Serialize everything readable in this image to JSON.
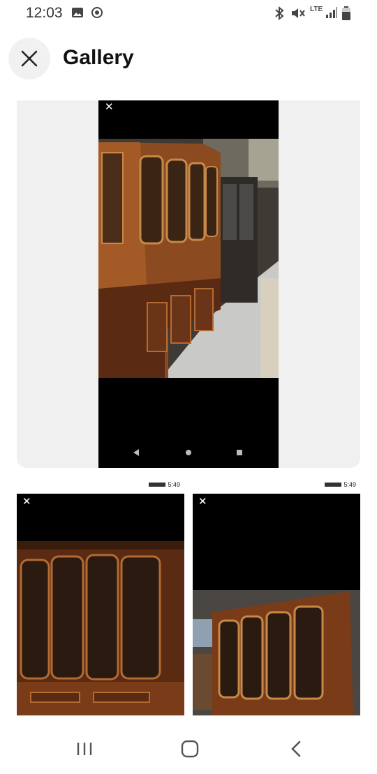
{
  "status_bar": {
    "time": "12:03",
    "network_label": "LTE",
    "icons": [
      "gallery-icon",
      "radio-icon",
      "bluetooth-icon",
      "mute-icon",
      "lte-icon",
      "signal-icon",
      "battery-icon"
    ]
  },
  "header": {
    "title": "Gallery",
    "close_icon": "close-icon"
  },
  "main_photo": {
    "close_glyph": "✕",
    "nav_icons": [
      "back-triangle-icon",
      "home-dot-icon",
      "recents-square-icon"
    ]
  },
  "thumbnails": [
    {
      "time": "5:49",
      "close_glyph": "✕"
    },
    {
      "time": "5:49",
      "close_glyph": "✕"
    }
  ],
  "nav_bar": {
    "icons": [
      "recents-icon",
      "home-icon",
      "back-icon"
    ]
  },
  "colors": {
    "wood_dark": "#5a2a12",
    "wood_mid": "#8b4a20",
    "wood_light": "#b66b33",
    "floor": "#c9c9c7",
    "card_bg": "#f0f0f0"
  }
}
